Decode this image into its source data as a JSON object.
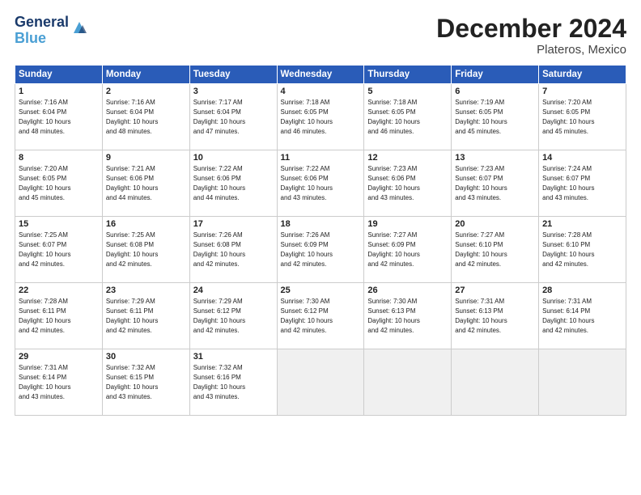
{
  "header": {
    "logo_line1": "General",
    "logo_line2": "Blue",
    "month_title": "December 2024",
    "location": "Plateros, Mexico"
  },
  "weekdays": [
    "Sunday",
    "Monday",
    "Tuesday",
    "Wednesday",
    "Thursday",
    "Friday",
    "Saturday"
  ],
  "weeks": [
    [
      {
        "day": "1",
        "info": "Sunrise: 7:16 AM\nSunset: 6:04 PM\nDaylight: 10 hours\nand 48 minutes."
      },
      {
        "day": "2",
        "info": "Sunrise: 7:16 AM\nSunset: 6:04 PM\nDaylight: 10 hours\nand 48 minutes."
      },
      {
        "day": "3",
        "info": "Sunrise: 7:17 AM\nSunset: 6:04 PM\nDaylight: 10 hours\nand 47 minutes."
      },
      {
        "day": "4",
        "info": "Sunrise: 7:18 AM\nSunset: 6:05 PM\nDaylight: 10 hours\nand 46 minutes."
      },
      {
        "day": "5",
        "info": "Sunrise: 7:18 AM\nSunset: 6:05 PM\nDaylight: 10 hours\nand 46 minutes."
      },
      {
        "day": "6",
        "info": "Sunrise: 7:19 AM\nSunset: 6:05 PM\nDaylight: 10 hours\nand 45 minutes."
      },
      {
        "day": "7",
        "info": "Sunrise: 7:20 AM\nSunset: 6:05 PM\nDaylight: 10 hours\nand 45 minutes."
      }
    ],
    [
      {
        "day": "8",
        "info": "Sunrise: 7:20 AM\nSunset: 6:05 PM\nDaylight: 10 hours\nand 45 minutes."
      },
      {
        "day": "9",
        "info": "Sunrise: 7:21 AM\nSunset: 6:06 PM\nDaylight: 10 hours\nand 44 minutes."
      },
      {
        "day": "10",
        "info": "Sunrise: 7:22 AM\nSunset: 6:06 PM\nDaylight: 10 hours\nand 44 minutes."
      },
      {
        "day": "11",
        "info": "Sunrise: 7:22 AM\nSunset: 6:06 PM\nDaylight: 10 hours\nand 43 minutes."
      },
      {
        "day": "12",
        "info": "Sunrise: 7:23 AM\nSunset: 6:06 PM\nDaylight: 10 hours\nand 43 minutes."
      },
      {
        "day": "13",
        "info": "Sunrise: 7:23 AM\nSunset: 6:07 PM\nDaylight: 10 hours\nand 43 minutes."
      },
      {
        "day": "14",
        "info": "Sunrise: 7:24 AM\nSunset: 6:07 PM\nDaylight: 10 hours\nand 43 minutes."
      }
    ],
    [
      {
        "day": "15",
        "info": "Sunrise: 7:25 AM\nSunset: 6:07 PM\nDaylight: 10 hours\nand 42 minutes."
      },
      {
        "day": "16",
        "info": "Sunrise: 7:25 AM\nSunset: 6:08 PM\nDaylight: 10 hours\nand 42 minutes."
      },
      {
        "day": "17",
        "info": "Sunrise: 7:26 AM\nSunset: 6:08 PM\nDaylight: 10 hours\nand 42 minutes."
      },
      {
        "day": "18",
        "info": "Sunrise: 7:26 AM\nSunset: 6:09 PM\nDaylight: 10 hours\nand 42 minutes."
      },
      {
        "day": "19",
        "info": "Sunrise: 7:27 AM\nSunset: 6:09 PM\nDaylight: 10 hours\nand 42 minutes."
      },
      {
        "day": "20",
        "info": "Sunrise: 7:27 AM\nSunset: 6:10 PM\nDaylight: 10 hours\nand 42 minutes."
      },
      {
        "day": "21",
        "info": "Sunrise: 7:28 AM\nSunset: 6:10 PM\nDaylight: 10 hours\nand 42 minutes."
      }
    ],
    [
      {
        "day": "22",
        "info": "Sunrise: 7:28 AM\nSunset: 6:11 PM\nDaylight: 10 hours\nand 42 minutes."
      },
      {
        "day": "23",
        "info": "Sunrise: 7:29 AM\nSunset: 6:11 PM\nDaylight: 10 hours\nand 42 minutes."
      },
      {
        "day": "24",
        "info": "Sunrise: 7:29 AM\nSunset: 6:12 PM\nDaylight: 10 hours\nand 42 minutes."
      },
      {
        "day": "25",
        "info": "Sunrise: 7:30 AM\nSunset: 6:12 PM\nDaylight: 10 hours\nand 42 minutes."
      },
      {
        "day": "26",
        "info": "Sunrise: 7:30 AM\nSunset: 6:13 PM\nDaylight: 10 hours\nand 42 minutes."
      },
      {
        "day": "27",
        "info": "Sunrise: 7:31 AM\nSunset: 6:13 PM\nDaylight: 10 hours\nand 42 minutes."
      },
      {
        "day": "28",
        "info": "Sunrise: 7:31 AM\nSunset: 6:14 PM\nDaylight: 10 hours\nand 42 minutes."
      }
    ],
    [
      {
        "day": "29",
        "info": "Sunrise: 7:31 AM\nSunset: 6:14 PM\nDaylight: 10 hours\nand 43 minutes."
      },
      {
        "day": "30",
        "info": "Sunrise: 7:32 AM\nSunset: 6:15 PM\nDaylight: 10 hours\nand 43 minutes."
      },
      {
        "day": "31",
        "info": "Sunrise: 7:32 AM\nSunset: 6:16 PM\nDaylight: 10 hours\nand 43 minutes."
      },
      {
        "day": "",
        "info": ""
      },
      {
        "day": "",
        "info": ""
      },
      {
        "day": "",
        "info": ""
      },
      {
        "day": "",
        "info": ""
      }
    ]
  ]
}
